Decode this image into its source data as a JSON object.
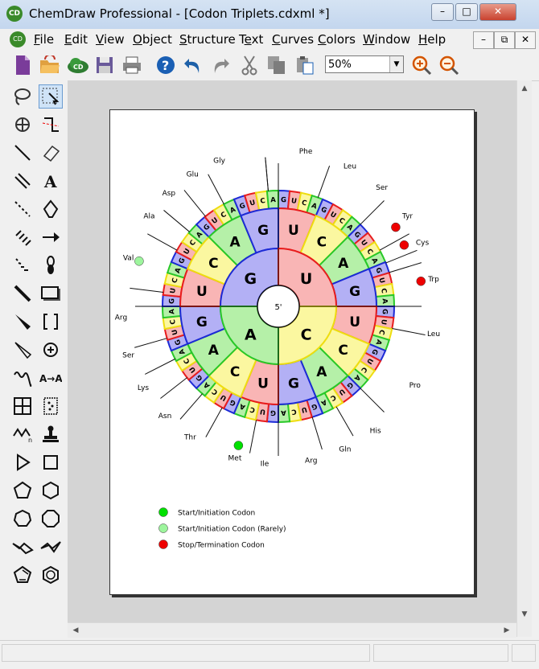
{
  "window": {
    "title": "ChemDraw Professional - [Codon Triplets.cdxml *]",
    "app_icon": "CD"
  },
  "menu": [
    "File",
    "Edit",
    "View",
    "Object",
    "Structure",
    "Text",
    "Curves",
    "Colors",
    "Window",
    "Help"
  ],
  "menu_mnemonic_index": [
    0,
    0,
    0,
    0,
    0,
    1,
    0,
    0,
    0,
    0
  ],
  "toolbar": {
    "icons": [
      "new-document-icon",
      "open-icon",
      "chemdraw-cloud-icon",
      "save-icon",
      "print-icon",
      "help-icon",
      "undo-icon",
      "redo-icon",
      "cut-icon",
      "copy-icon",
      "paste-icon"
    ],
    "zoom": "50%",
    "zoom_in_icon": "zoom-in-icon",
    "zoom_out_icon": "zoom-out-icon"
  },
  "palette_tools": [
    "lasso-icon",
    "marquee-select-icon",
    "structure-perspective-icon",
    "mass-fragment-icon",
    "solid-bond-icon",
    "eraser-icon",
    "multiple-bond-icon",
    "text-tool-icon",
    "dashed-bond-icon",
    "pen-icon",
    "hashed-bond-icon",
    "arrow-icon",
    "hashed-wedge-icon",
    "orbital-icon",
    "bold-bond-icon",
    "rectangle-drawing-icon",
    "wedge-bond-icon",
    "brackets-icon",
    "hollow-wedge-icon",
    "charge-icon",
    "wavy-bond-icon",
    "reaction-atom-icon",
    "table-icon",
    "tlc-plate-icon",
    "chain-icon",
    "stamp-icon",
    "triangle-icon",
    "square-icon",
    "pentagon-icon",
    "hexagon-icon",
    "heptagon-icon",
    "octagon-icon",
    "cyclohexane-chair-1-icon",
    "cyclohexane-chair-2-icon",
    "cyclopentadiene-icon",
    "benzene-icon"
  ],
  "colors": {
    "U": "#f9b5b5",
    "C": "#fbf7a0",
    "A": "#b5f0a8",
    "G": "#b3b0f5",
    "U_border": "#e81c1c",
    "C_border": "#eedd10",
    "A_border": "#28c828",
    "G_border": "#1c2ad6",
    "start": "#00e000",
    "start_rare": "#9df59d",
    "stop": "#ee0000"
  },
  "diagram": {
    "center_label": "5'",
    "inner_ring": [
      "G",
      "U",
      "C",
      "A"
    ],
    "middle_ring": [
      "U",
      "C",
      "A",
      "G",
      "U",
      "C",
      "A",
      "G",
      "U",
      "C",
      "A",
      "G",
      "U",
      "C",
      "A",
      "G"
    ],
    "outer_ring": "GUCAGUCAGUCAGUCAGUCAGUCAGUCAGUCAGUCAGUCAGUCAGUCAGUCAGUCAGUCAGUCA",
    "amino_acids": [
      {
        "name": "Gly"
      },
      {
        "name": "Glu"
      },
      {
        "name": "Asp"
      },
      {
        "name": "Ala"
      },
      {
        "name": "Val"
      },
      {
        "name": "Arg"
      },
      {
        "name": "Ser"
      },
      {
        "name": "Lys"
      },
      {
        "name": "Asn"
      },
      {
        "name": "Thr"
      },
      {
        "name": "Met"
      },
      {
        "name": "Ile"
      },
      {
        "name": "Arg"
      },
      {
        "name": "Gln"
      },
      {
        "name": "His"
      },
      {
        "name": "Pro"
      },
      {
        "name": "Leu"
      },
      {
        "name": "Trp"
      },
      {
        "name": "Cys"
      },
      {
        "name": "Tyr"
      },
      {
        "name": "Ser"
      },
      {
        "name": "Leu"
      },
      {
        "name": "Phe"
      }
    ]
  },
  "legend": [
    {
      "label": "Start/Initiation Codon",
      "color": "#00e000"
    },
    {
      "label": "Start/Initiation Codon (Rarely)",
      "color": "#9df59d"
    },
    {
      "label": "Stop/Termination Codon",
      "color": "#ee0000"
    }
  ]
}
